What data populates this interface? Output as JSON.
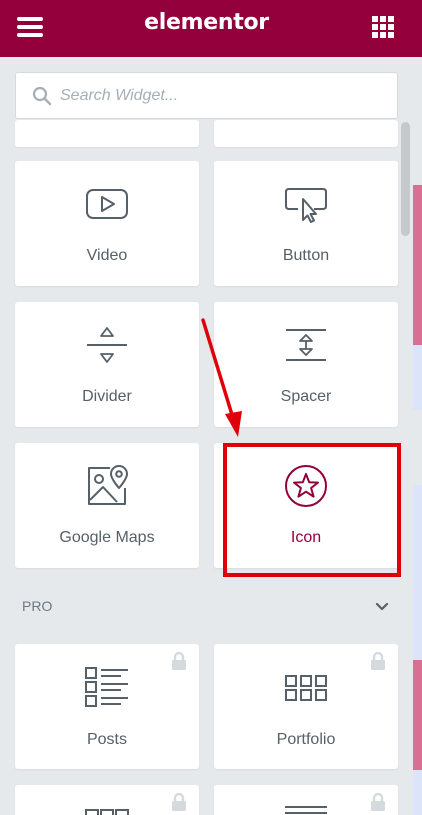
{
  "header": {
    "logo": "elementor",
    "color": "#93003c"
  },
  "search": {
    "placeholder": "Search Widget..."
  },
  "widgets": [
    {
      "label": "Video",
      "icon": "video-play-icon"
    },
    {
      "label": "Button",
      "icon": "button-cursor-icon"
    },
    {
      "label": "Divider",
      "icon": "divider-icon"
    },
    {
      "label": "Spacer",
      "icon": "spacer-icon"
    },
    {
      "label": "Google Maps",
      "icon": "map-pin-icon"
    },
    {
      "label": "Icon",
      "icon": "star-circle-icon",
      "selected": true
    }
  ],
  "pro_section": {
    "title": "PRO",
    "widgets": [
      {
        "label": "Posts",
        "icon": "posts-list-icon",
        "locked": true
      },
      {
        "label": "Portfolio",
        "icon": "portfolio-grid-icon",
        "locked": true
      }
    ]
  },
  "annotation": {
    "highlight_color": "#e0000a"
  }
}
